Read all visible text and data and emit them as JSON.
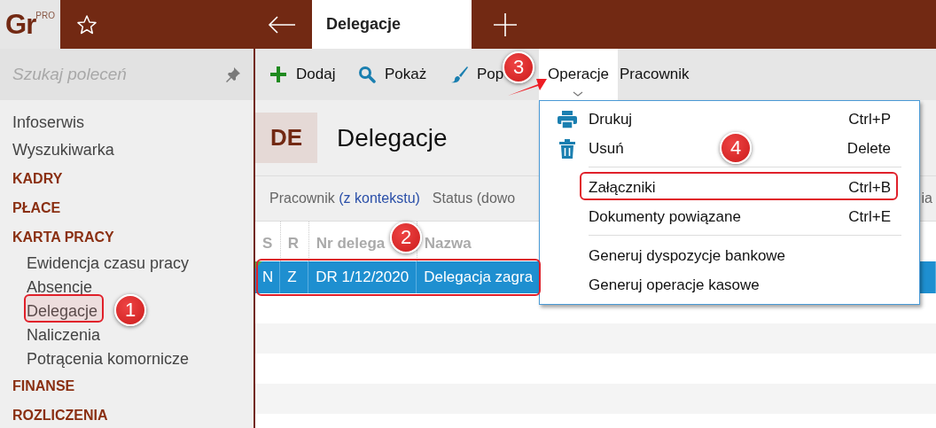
{
  "app": {
    "logo": "Gr",
    "edition": "PRO"
  },
  "tabs": [
    {
      "label": "Delegacje",
      "selected": true
    }
  ],
  "sidebar": {
    "search": {
      "placeholder": "Szukaj poleceń"
    },
    "items": [
      {
        "label": "Infoserwis",
        "kind": "link"
      },
      {
        "label": "Wyszukiwarka",
        "kind": "link"
      },
      {
        "label": "KADRY",
        "kind": "section"
      },
      {
        "label": "PŁACE",
        "kind": "section"
      },
      {
        "label": "KARTA PRACY",
        "kind": "section",
        "children": [
          {
            "label": "Ewidencja czasu pracy"
          },
          {
            "label": "Absencje"
          },
          {
            "label": "Delegacje"
          },
          {
            "label": "Naliczenia"
          },
          {
            "label": "Potrącenia komornicze"
          }
        ]
      },
      {
        "label": "FINANSE",
        "kind": "section"
      },
      {
        "label": "ROZLICZENIA",
        "kind": "section"
      }
    ]
  },
  "toolbar": [
    {
      "label": "Dodaj",
      "expanded": false
    },
    {
      "label": "Pokaż",
      "expanded": false
    },
    {
      "label": "Pop",
      "expanded": false
    },
    {
      "label": "Operacje",
      "expanded": true
    },
    {
      "label": "Pracownik",
      "expanded": false
    }
  ],
  "page": {
    "badge": "DE",
    "title": "Delegacje"
  },
  "filters": [
    {
      "label": "Pracownik",
      "context": "(z kontekstu)"
    },
    {
      "label": "Status (dowo"
    },
    {
      "label": "ia"
    }
  ],
  "table": {
    "columns": [
      "S",
      "R",
      "Nr delega",
      "Nazwa"
    ],
    "rows": [
      {
        "cells": [
          "N",
          "Z",
          "DR 1/12/2020",
          "Delegacja zagra"
        ],
        "selected": true
      }
    ]
  },
  "menu": [
    {
      "kind": "item",
      "label": "Drukuj",
      "shortcut": "Ctrl+P"
    },
    {
      "kind": "item",
      "label": "Usuń",
      "shortcut": "Delete"
    },
    {
      "kind": "separator"
    },
    {
      "kind": "item",
      "label": "Załączniki",
      "shortcut": "Ctrl+B"
    },
    {
      "kind": "item",
      "label": "Dokumenty powiązane",
      "shortcut": "Ctrl+E"
    },
    {
      "kind": "separator"
    },
    {
      "kind": "item",
      "label": "Generuj dyspozycje bankowe"
    },
    {
      "kind": "item",
      "label": "Generuj operacje kasowe"
    }
  ],
  "annotations": [
    {
      "number": "1"
    },
    {
      "number": "2"
    },
    {
      "number": "3"
    },
    {
      "number": "4"
    }
  ]
}
